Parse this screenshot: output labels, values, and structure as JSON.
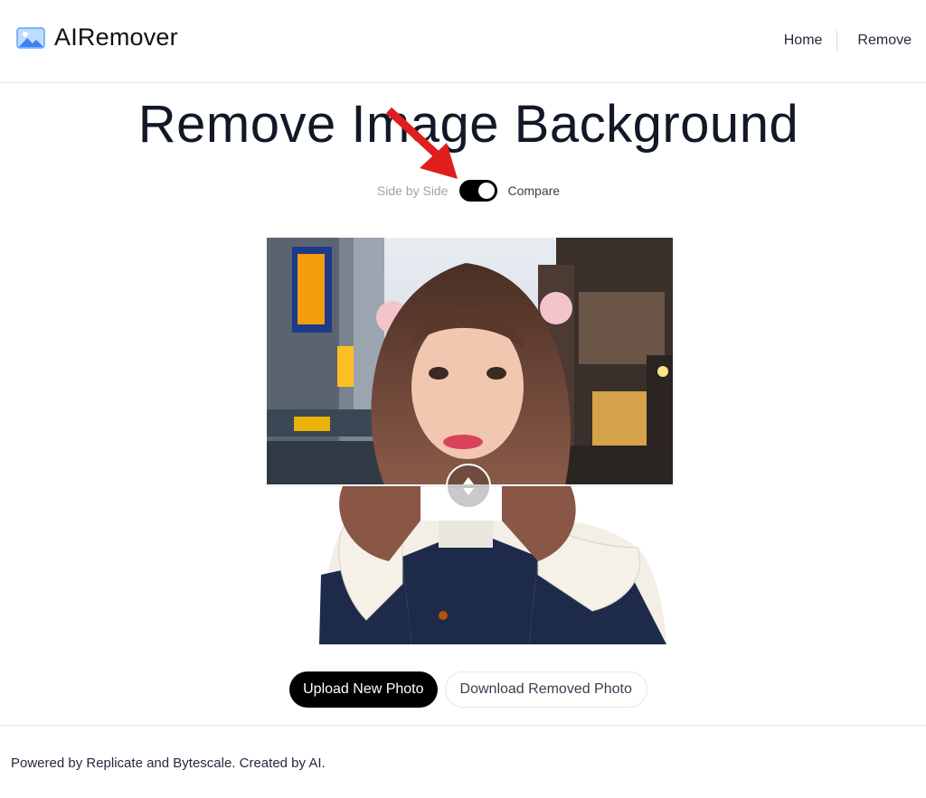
{
  "header": {
    "brand": "AIRemover",
    "brand_icon": "image-icon",
    "nav": [
      {
        "label": "Home"
      },
      {
        "label": "Remove"
      }
    ]
  },
  "main": {
    "title": "Remove Image Background",
    "toggle": {
      "left_label": "Side by Side",
      "right_label": "Compare",
      "state": "on"
    },
    "compare": {
      "handle_icon": "up-down-arrows-icon"
    },
    "buttons": {
      "upload": "Upload New Photo",
      "download": "Download Removed Photo"
    }
  },
  "footer": {
    "text": "Powered by Replicate and Bytescale. Created by AI."
  },
  "colors": {
    "accent_arrow": "#e11d1d",
    "primary_button": "#000000",
    "brand_icon": "#60a5fa"
  }
}
